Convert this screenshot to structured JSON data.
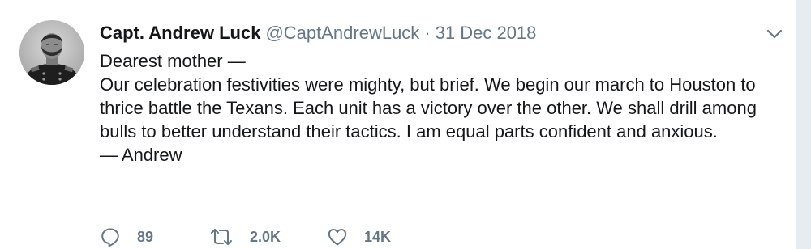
{
  "tweet": {
    "display_name": "Capt. Andrew Luck",
    "handle": "@CaptAndrewLuck",
    "separator": "·",
    "date": "31 Dec 2018",
    "lines": [
      "Dearest mother —",
      "Our celebration festivities were mighty, but brief. We begin our march to Houston to thrice battle the Texans. Each unit has a victory over the other. We shall drill among bulls to better understand their tactics. I am equal parts confident and anxious.",
      "— Andrew"
    ]
  },
  "actions": {
    "replies": "89",
    "retweets": "2.0K",
    "likes": "14K"
  },
  "icons": {
    "avatar": "avatar",
    "caret": "chevron-down-icon",
    "reply": "reply-icon",
    "retweet": "retweet-icon",
    "like": "heart-icon"
  },
  "colors": {
    "name": "#14171a",
    "secondary": "#657786",
    "background": "#ffffff",
    "page": "#e6ecf0"
  }
}
